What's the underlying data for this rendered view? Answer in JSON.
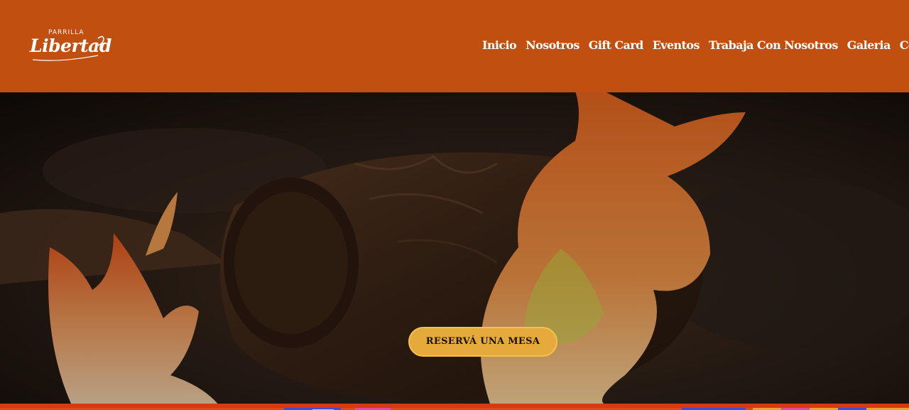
{
  "brand": {
    "logo_top": "PARRILLA",
    "logo_main": "Libertad",
    "colors": {
      "header_bg": "#c04f10",
      "cta_bg": "#e5a93c",
      "cta_border": "#f2c24a"
    }
  },
  "nav": {
    "items": [
      {
        "label": "Inicio"
      },
      {
        "label": "Nosotros"
      },
      {
        "label": "Gift Card"
      },
      {
        "label": "Eventos"
      },
      {
        "label": "Trabaja Con Nosotros"
      },
      {
        "label": "Galeria"
      },
      {
        "label": "Contacto"
      }
    ]
  },
  "hero": {
    "image": "fire-log-background",
    "cta_label": "RESERVÁ UNA MESA"
  },
  "footer_strip": {
    "image": "colorful-pattern-strip"
  }
}
